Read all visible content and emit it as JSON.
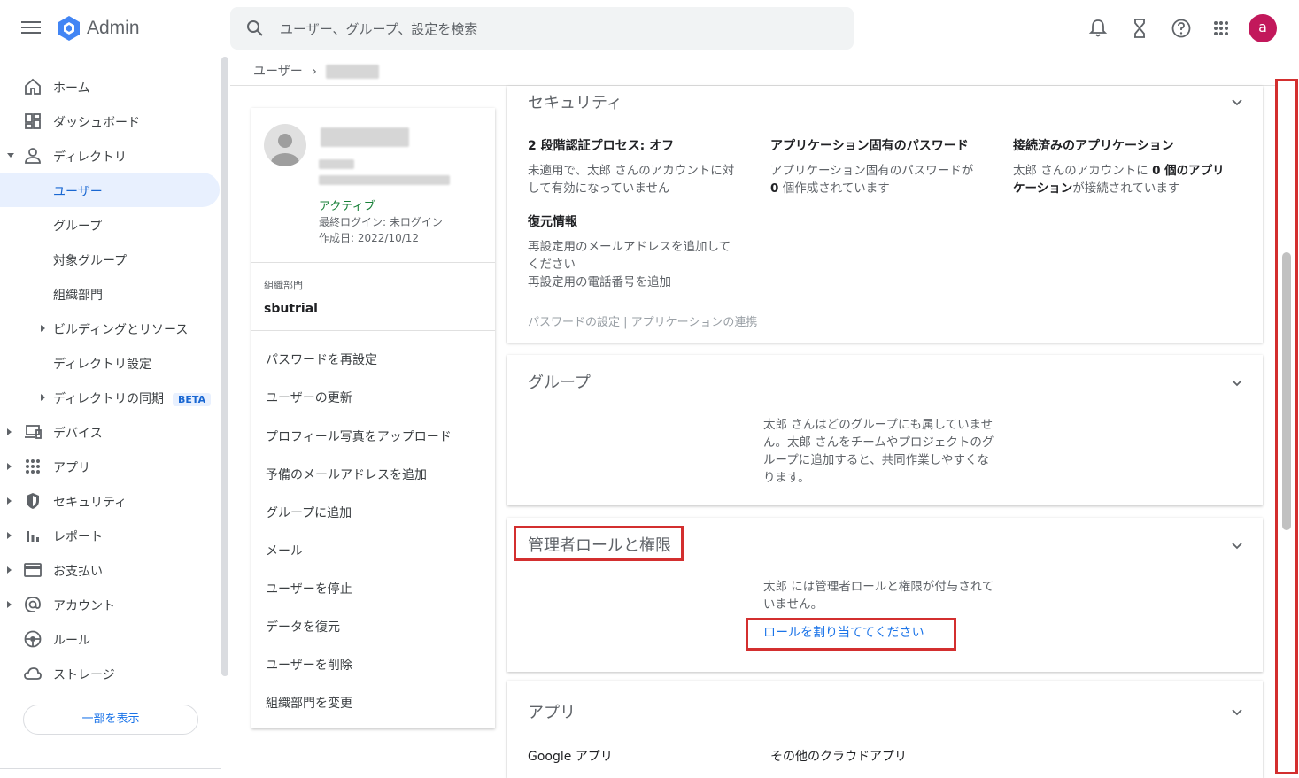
{
  "app": {
    "title": "Admin"
  },
  "search": {
    "placeholder": "ユーザー、グループ、設定を検索"
  },
  "avatar": {
    "initial": "a",
    "color": "#c2185b"
  },
  "sidebar": {
    "items": [
      {
        "label": "ホーム",
        "icon": "home-icon"
      },
      {
        "label": "ダッシュボード",
        "icon": "dashboard-icon"
      },
      {
        "label": "ディレクトリ",
        "icon": "person-icon"
      },
      {
        "label": "ユーザー"
      },
      {
        "label": "グループ"
      },
      {
        "label": "対象グループ"
      },
      {
        "label": "組織部門"
      },
      {
        "label": "ビルディングとリソース"
      },
      {
        "label": "ディレクトリ設定"
      },
      {
        "label": "ディレクトリの同期",
        "badge": "BETA"
      },
      {
        "label": "デバイス",
        "icon": "devices-icon"
      },
      {
        "label": "アプリ",
        "icon": "apps-grid-icon"
      },
      {
        "label": "セキュリティ",
        "icon": "shield-icon"
      },
      {
        "label": "レポート",
        "icon": "bar-chart-icon"
      },
      {
        "label": "お支払い",
        "icon": "credit-card-icon"
      },
      {
        "label": "アカウント",
        "icon": "at-sign-icon"
      },
      {
        "label": "ルール",
        "icon": "rules-icon"
      },
      {
        "label": "ストレージ",
        "icon": "cloud-icon"
      }
    ],
    "show_less": "一部を表示"
  },
  "breadcrumb": {
    "root": "ユーザー",
    "sep": "›"
  },
  "user_card": {
    "status": "アクティブ",
    "last_login": "最終ログイン: 未ログイン",
    "created": "作成日: 2022/10/12",
    "org_label": "組織部門",
    "org_value": "sbutrial",
    "actions": [
      "パスワードを再設定",
      "ユーザーの更新",
      "プロフィール写真をアップロード",
      "予備のメールアドレスを追加",
      "グループに追加",
      "メール",
      "ユーザーを停止",
      "データを復元",
      "ユーザーを削除",
      "組織部門を変更"
    ]
  },
  "security": {
    "title": "セキュリティ",
    "col1_title": "2 段階認証プロセス: オフ",
    "col1_text1": "未適用で、太郎 さんのアカウントに対",
    "col1_text2": "して有効になっていません",
    "col2_title": "アプリケーション固有のパスワード",
    "col2_text1": "アプリケーション固有のパスワードが",
    "col2_text2_bold": "0",
    "col2_text2": " 個作成されています",
    "col3_title": "接続済みのアプリケーション",
    "col3_text1": "太郎 さんのアカウントに ",
    "col3_text1_bold": "0 個のアプリ",
    "col3_text2_bold": "ケーション",
    "col3_text2": "が接続されています",
    "recovery_title": "復元情報",
    "recovery_line1": "再設定用のメールアドレスを追加して",
    "recovery_line2": "ください",
    "recovery_line3": "再設定用の電話番号を追加",
    "footer_links": "パスワードの設定 | アプリケーションの連携"
  },
  "groups": {
    "title": "グループ",
    "line1": "太郎 さんはどのグループにも属していませ",
    "line2": "ん。太郎 さんをチームやプロジェクトのグ",
    "line3": "ループに追加すると、共同作業しやすくな",
    "line4": "ります。"
  },
  "admin_roles": {
    "title": "管理者ロールと権限",
    "line1": "太郎 には管理者ロールと権限が付与されて",
    "line2": "いません。",
    "assign_link": "ロールを割り当ててください"
  },
  "apps": {
    "title": "アプリ",
    "col1": "Google アプリ",
    "col2": "その他のクラウドアプリ"
  },
  "colors": {
    "accent": "#1a73e8",
    "active_bg": "#e8f0fe",
    "status_green": "#188038",
    "highlight_red": "#d32f2f"
  }
}
